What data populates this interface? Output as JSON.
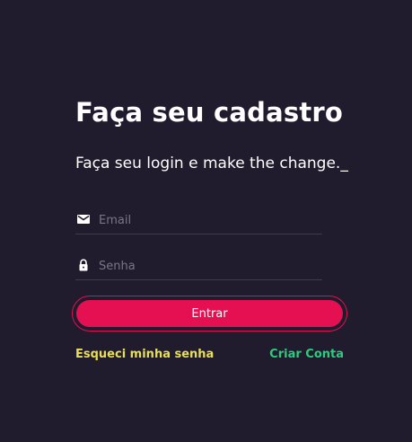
{
  "form": {
    "title": "Faça seu cadastro",
    "subtitle": "Faça seu login e make the change._",
    "email": {
      "icon": "mail-icon",
      "placeholder": "Email",
      "value": ""
    },
    "password": {
      "icon": "lock-icon",
      "placeholder": "Senha",
      "value": ""
    },
    "submit_label": "Entrar",
    "forgot_label": "Esqueci minha senha",
    "create_label": "Criar Conta"
  },
  "colors": {
    "background": "#201b2d",
    "accent": "#e41051",
    "forgot_link": "#e9df57",
    "create_link": "#25d07d"
  }
}
